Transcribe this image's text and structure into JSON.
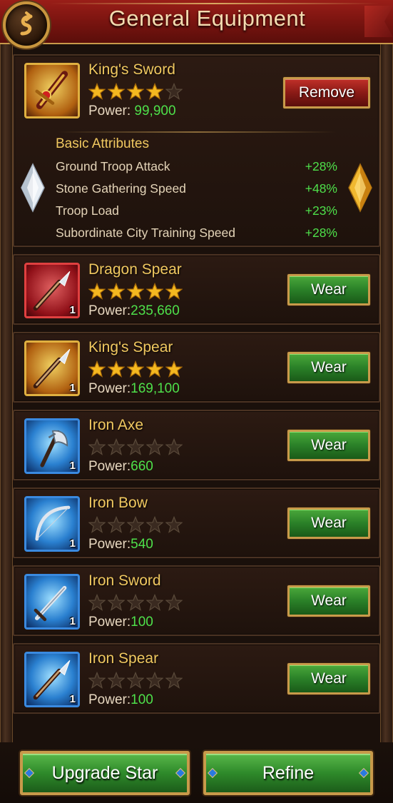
{
  "header": {
    "title": "General Equipment"
  },
  "equipped": {
    "name": "King's Sword",
    "stars": 4,
    "max_stars": 5,
    "power_label": "Power:",
    "power": "99,900",
    "frame": "gold",
    "action_label": "Remove",
    "attributes_title": "Basic Attributes",
    "attributes": [
      {
        "name": "Ground Troop Attack",
        "value": "+28%"
      },
      {
        "name": "Stone Gathering Speed",
        "value": "+48%"
      },
      {
        "name": "Troop Load",
        "value": "+23%"
      },
      {
        "name": "Subordinate City Training Speed",
        "value": "+28%"
      }
    ]
  },
  "items": [
    {
      "name": "Dragon Spear",
      "stars": 5,
      "power_label": "Power:",
      "power": "235,660",
      "qty": "1",
      "frame": "red",
      "icon": "spear-icon",
      "action_label": "Wear"
    },
    {
      "name": "King's Spear",
      "stars": 5,
      "power_label": "Power:",
      "power": "169,100",
      "qty": "1",
      "frame": "gold",
      "icon": "spear-icon",
      "action_label": "Wear"
    },
    {
      "name": "Iron Axe",
      "stars": 0,
      "power_label": "Power:",
      "power": "660",
      "qty": "1",
      "frame": "blue",
      "icon": "axe-icon",
      "action_label": "Wear"
    },
    {
      "name": "Iron Bow",
      "stars": 0,
      "power_label": "Power:",
      "power": "540",
      "qty": "1",
      "frame": "blue",
      "icon": "bow-icon",
      "action_label": "Wear"
    },
    {
      "name": "Iron Sword",
      "stars": 0,
      "power_label": "Power:",
      "power": "100",
      "qty": "1",
      "frame": "blue",
      "icon": "sword-icon",
      "action_label": "Wear"
    },
    {
      "name": "Iron Spear",
      "stars": 0,
      "power_label": "Power:",
      "power": "100",
      "qty": "1",
      "frame": "blue",
      "icon": "spear-icon",
      "action_label": "Wear"
    }
  ],
  "footer": {
    "upgrade_label": "Upgrade Star",
    "refine_label": "Refine"
  },
  "colors": {
    "power_value": "#4ee04a",
    "header": "#8a1a14",
    "wear_button": "#2a8028",
    "remove_button": "#8a1a16"
  }
}
